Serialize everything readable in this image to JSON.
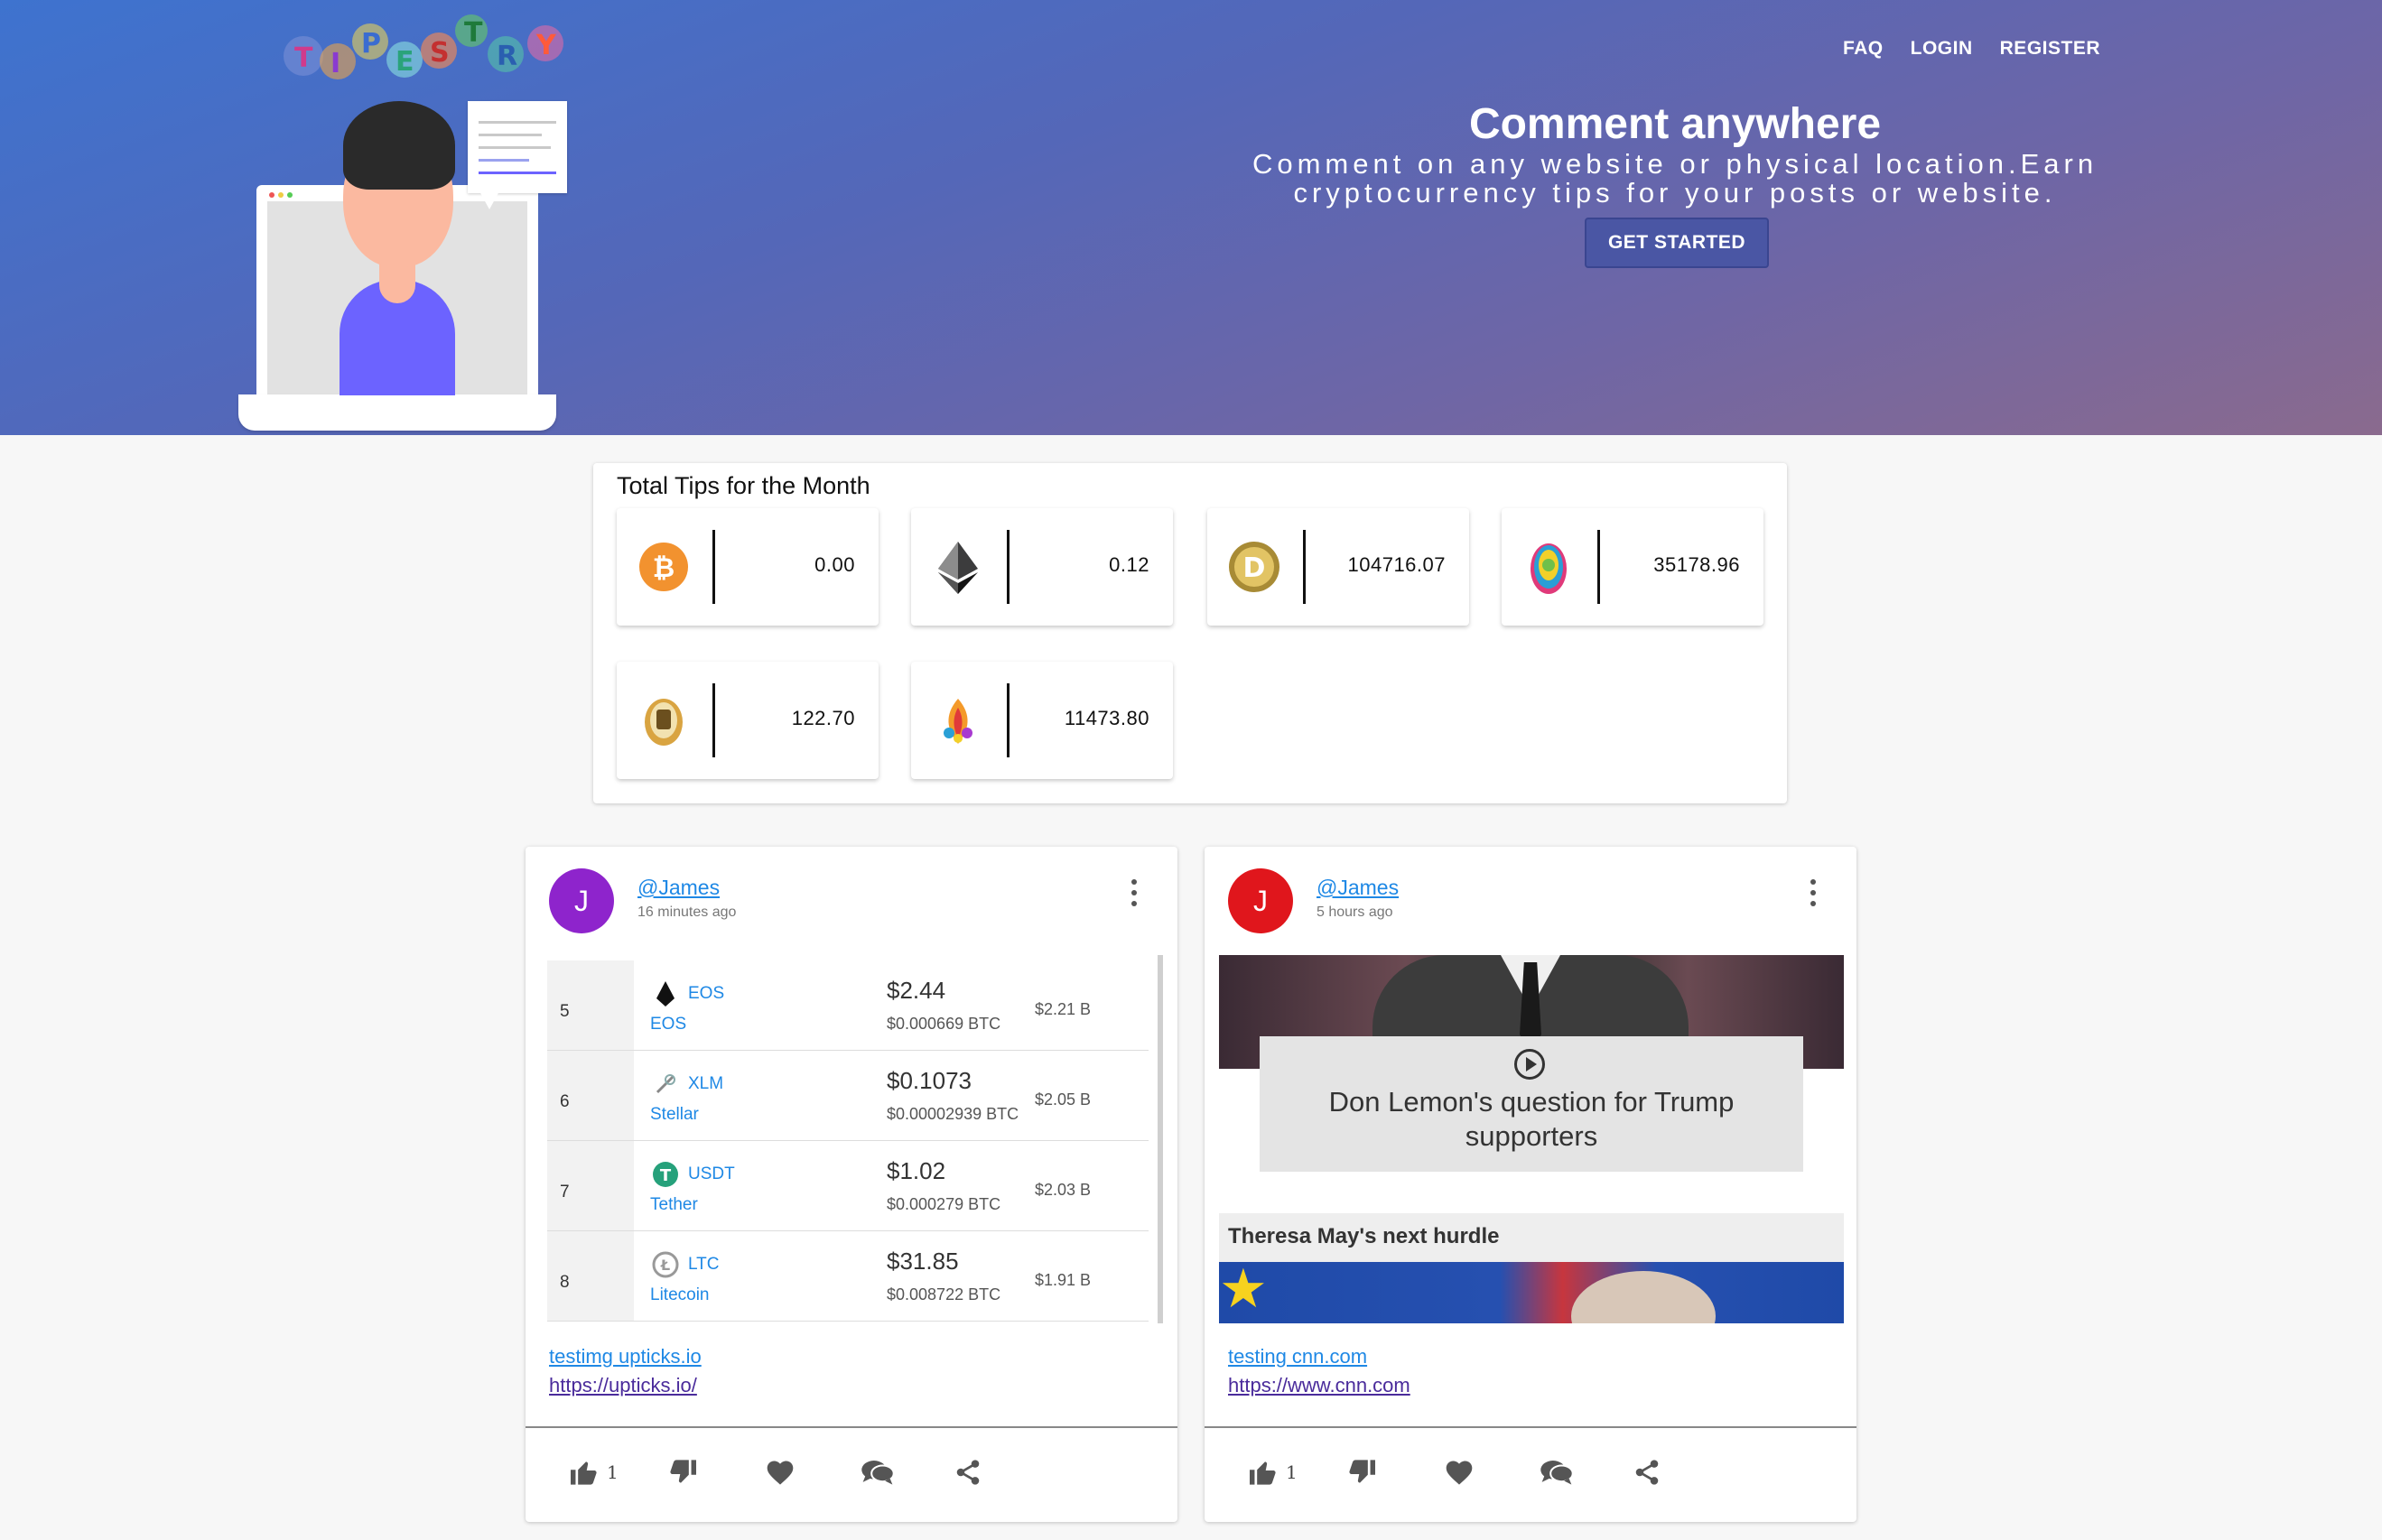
{
  "nav": {
    "items": [
      "FAQ",
      "LOGIN",
      "REGISTER"
    ]
  },
  "logo": {
    "letters": [
      "T",
      "I",
      "P",
      "E",
      "S",
      "T",
      "R",
      "Y"
    ]
  },
  "hero": {
    "title": "Comment anywhere",
    "subtitle_line1": "Comment on any website or physical location.Earn",
    "subtitle_line2": "cryptocurrency tips for your posts or website.",
    "cta": "GET STARTED"
  },
  "tips": {
    "title": "Total Tips for the Month",
    "items": [
      {
        "coin": "bitcoin-icon",
        "value": "0.00"
      },
      {
        "coin": "ethereum-icon",
        "value": "0.12"
      },
      {
        "coin": "dogecoin-icon",
        "value": "104716.07"
      },
      {
        "coin": "coin-4-icon",
        "value": "35178.96"
      },
      {
        "coin": "coin-5-icon",
        "value": "122.70"
      },
      {
        "coin": "coin-6-icon",
        "value": "11473.80"
      }
    ]
  },
  "posts": [
    {
      "avatar_letter": "J",
      "avatar_color": "#8e24cc",
      "handle": "@James",
      "time": "16 minutes ago",
      "link_title": "testimg upticks.io",
      "url": "https://upticks.io/",
      "likes": "1",
      "preview": {
        "rows": [
          {
            "rank": "5",
            "symbol": "EOS",
            "name": "EOS",
            "price": "$2.44",
            "btc": "$0.000669 BTC",
            "cap": "$2.21 B"
          },
          {
            "rank": "6",
            "symbol": "XLM",
            "name": "Stellar",
            "price": "$0.1073",
            "btc": "$0.00002939 BTC",
            "cap": "$2.05 B"
          },
          {
            "rank": "7",
            "symbol": "USDT",
            "name": "Tether",
            "price": "$1.02",
            "btc": "$0.000279 BTC",
            "cap": "$2.03 B"
          },
          {
            "rank": "8",
            "symbol": "LTC",
            "name": "Litecoin",
            "price": "$31.85",
            "btc": "$0.008722 BTC",
            "cap": "$1.91 B"
          }
        ]
      }
    },
    {
      "avatar_letter": "J",
      "avatar_color": "#e0161c",
      "handle": "@James",
      "time": "5 hours ago",
      "link_title": "testing cnn.com",
      "url": "https://www.cnn.com",
      "likes": "1",
      "preview": {
        "video_caption_line1": "Don Lemon's question for Trump",
        "video_caption_line2": "supporters",
        "headline": "Theresa May's next hurdle"
      }
    }
  ],
  "colors": {
    "link": "#1e88e5",
    "hero_start": "#3e73cf",
    "hero_end": "#8a6a8e",
    "cta_bg": "#4a56a4"
  }
}
